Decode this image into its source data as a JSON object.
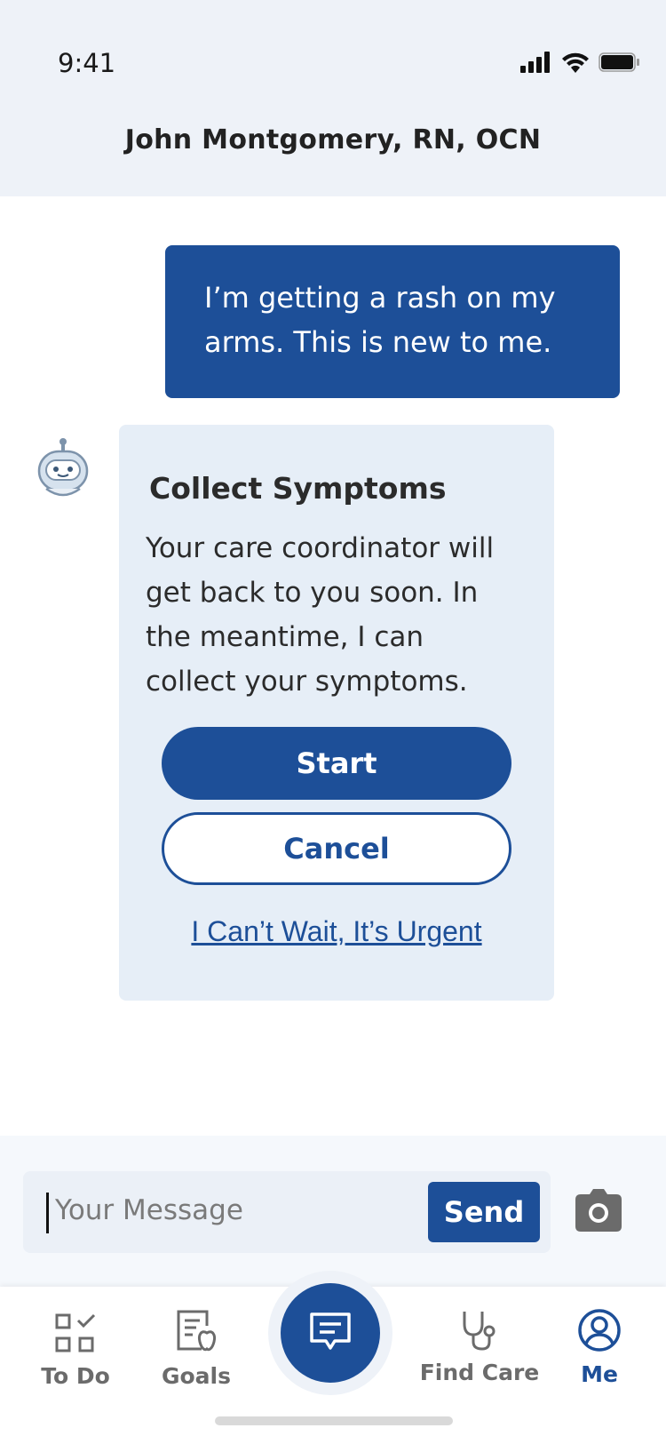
{
  "status_bar": {
    "time": "9:41"
  },
  "header": {
    "title": "John Montgomery, RN, OCN"
  },
  "messages": {
    "outgoing_text": "I’m getting a rash on my arms. This is new to me."
  },
  "bot_card": {
    "title": "Collect Symptoms",
    "text": "Your care coordinator will get back to you soon. In the meantime, I can collect your symptoms.",
    "start_label": "Start",
    "cancel_label": "Cancel",
    "urgent_link": "I Can’t Wait, It’s Urgent"
  },
  "composer": {
    "placeholder": "Your Message",
    "send_label": "Send"
  },
  "nav": {
    "todo": "To Do",
    "goals": "Goals",
    "find_care": "Find Care",
    "me": "Me",
    "active": "Me"
  },
  "colors": {
    "brand": "#1d4f98",
    "header_bg": "#eef2f8",
    "card_bg": "#e6eef7"
  },
  "icons": [
    "signal-icon",
    "wifi-icon",
    "battery-icon",
    "robot-avatar-icon",
    "camera-icon",
    "todo-icon",
    "goals-icon",
    "chat-icon",
    "stethoscope-icon",
    "profile-icon"
  ]
}
